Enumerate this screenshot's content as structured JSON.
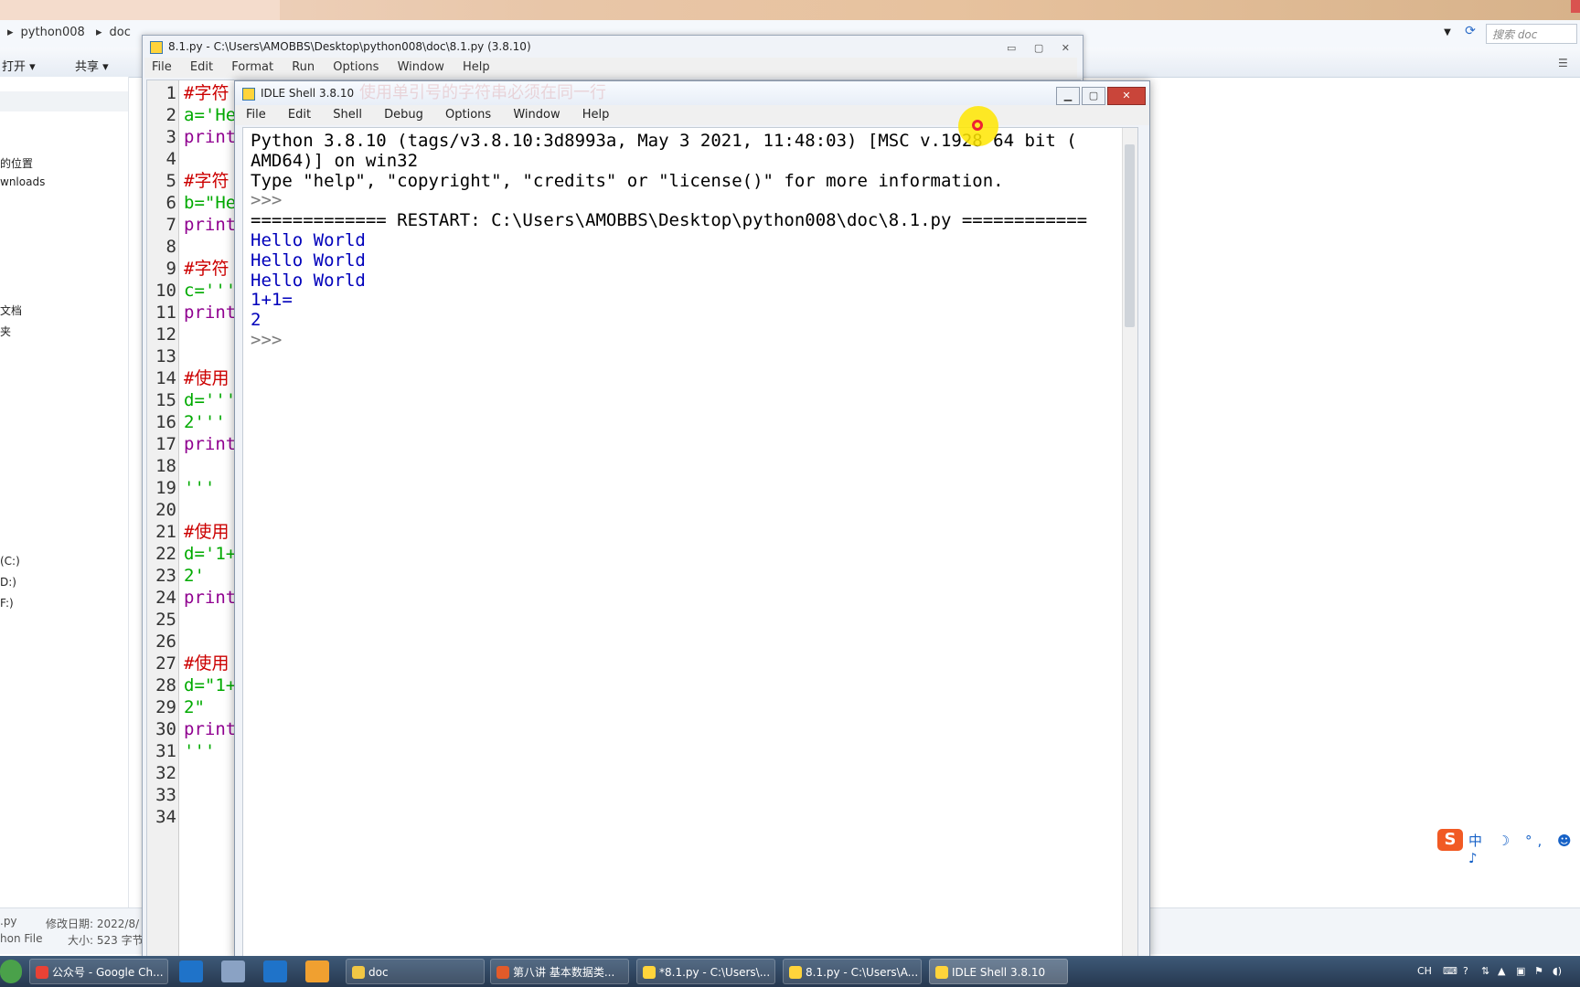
{
  "explorer": {
    "breadcrumb": [
      "python008",
      "doc"
    ],
    "search_placeholder": "搜索 doc",
    "toolbar": {
      "open_label": "打开 ▾",
      "share_label": "共享 ▾"
    },
    "nav_items": [
      "的位置",
      "wnloads",
      "文档",
      "夹",
      "(C:)",
      "D:)",
      "F:)"
    ],
    "status": {
      "name": ".py",
      "modified_label": "修改日期: 2022/8/",
      "type": "hon File",
      "size_label": "大小: 523 字节"
    }
  },
  "editor": {
    "title": "8.1.py - C:\\Users\\AMOBBS\\Desktop\\python008\\doc\\8.1.py (3.8.10)",
    "menu": [
      "File",
      "Edit",
      "Format",
      "Run",
      "Options",
      "Window",
      "Help"
    ],
    "line_numbers": [
      "1",
      "2",
      "3",
      "4",
      "5",
      "6",
      "7",
      "8",
      "9",
      "10",
      "11",
      "12",
      "13",
      "14",
      "15",
      "16",
      "17",
      "18",
      "19",
      "20",
      "21",
      "22",
      "23",
      "24",
      "25",
      "26",
      "27",
      "28",
      "29",
      "30",
      "31",
      "32",
      "33",
      "34"
    ],
    "code": [
      {
        "line": 1,
        "text": "#字符",
        "kind": "comment"
      },
      {
        "line": 2,
        "text": "a='He",
        "kind": "str"
      },
      {
        "line": 3,
        "text": "print",
        "kind": "kw"
      },
      {
        "line": 5,
        "text": "#字符",
        "kind": "comment"
      },
      {
        "line": 6,
        "text": "b=\"He",
        "kind": "str"
      },
      {
        "line": 7,
        "text": "print",
        "kind": "kw"
      },
      {
        "line": 9,
        "text": "#字符",
        "kind": "comment"
      },
      {
        "line": 10,
        "text": "c='''",
        "kind": "str"
      },
      {
        "line": 11,
        "text": "print",
        "kind": "kw"
      },
      {
        "line": 14,
        "text": "#使用",
        "kind": "comment"
      },
      {
        "line": 15,
        "text": "d='''",
        "kind": "str"
      },
      {
        "line": 16,
        "text": "2'''",
        "kind": "str"
      },
      {
        "line": 17,
        "text": "print",
        "kind": "kw"
      },
      {
        "line": 19,
        "text": "'''",
        "kind": "str"
      },
      {
        "line": 21,
        "text": "#使用",
        "kind": "comment"
      },
      {
        "line": 22,
        "text": "d='1+",
        "kind": "str"
      },
      {
        "line": 23,
        "text": "2'",
        "kind": "str"
      },
      {
        "line": 24,
        "text": "print",
        "kind": "kw"
      },
      {
        "line": 27,
        "text": "#使用",
        "kind": "comment"
      },
      {
        "line": 28,
        "text": "d=\"1+",
        "kind": "str"
      },
      {
        "line": 29,
        "text": "2\"",
        "kind": "str"
      },
      {
        "line": 30,
        "text": "print",
        "kind": "kw"
      },
      {
        "line": 31,
        "text": "'''",
        "kind": "str"
      }
    ]
  },
  "shell": {
    "title": "IDLE Shell 3.8.10",
    "ghost_title": "使用单引号的字符串必须在同一行",
    "menu": [
      "File",
      "Edit",
      "Shell",
      "Debug",
      "Options",
      "Window",
      "Help"
    ],
    "lines": [
      {
        "text": "Python 3.8.10 (tags/v3.8.10:3d8993a, May  3 2021, 11:48:03) [MSC v.1928 64 bit (",
        "kind": "plain"
      },
      {
        "text": "AMD64)] on win32",
        "kind": "plain"
      },
      {
        "text": "Type \"help\", \"copyright\", \"credits\" or \"license()\" for more information.",
        "kind": "plain"
      },
      {
        "text": ">>>",
        "kind": "prompt"
      },
      {
        "text": "============= RESTART: C:\\Users\\AMOBBS\\Desktop\\python008\\doc\\8.1.py ============",
        "kind": "plain"
      },
      {
        "text": "Hello World",
        "kind": "out"
      },
      {
        "text": "Hello World",
        "kind": "out"
      },
      {
        "text": "Hello World",
        "kind": "out"
      },
      {
        "text": "1+1=",
        "kind": "out"
      },
      {
        "text": "2",
        "kind": "out"
      },
      {
        "text": ">>>",
        "kind": "prompt"
      }
    ]
  },
  "ime": {
    "logo": "S",
    "text": "中 ☽ °, ☻ ♪"
  },
  "taskbar": {
    "items": [
      {
        "label": "公众号 - Google Ch...",
        "color": "#e94235"
      },
      {
        "label": "doc",
        "color": "#f2c744"
      },
      {
        "label": "第八讲 基本数据类...",
        "color": "#e25b2a"
      },
      {
        "label": "*8.1.py - C:\\Users\\...",
        "color": "#ffd43b"
      },
      {
        "label": "8.1.py - C:\\Users\\A...",
        "color": "#ffd43b"
      },
      {
        "label": "IDLE Shell 3.8.10",
        "color": "#ffd43b"
      }
    ],
    "tray_lang": "CH"
  }
}
